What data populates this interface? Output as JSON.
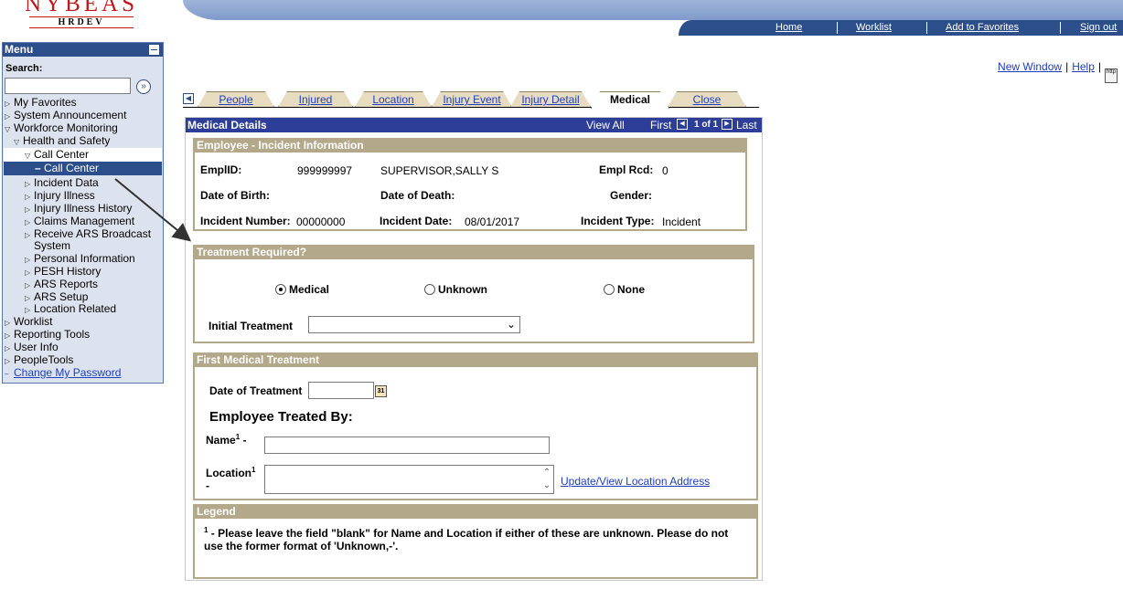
{
  "header": {
    "brand": "NYBEAS",
    "environment": "HRDEV",
    "nav": [
      "Home",
      "Worklist",
      "Add to Favorites",
      "Sign out"
    ],
    "utility": {
      "new_window": "New Window",
      "help": "Help",
      "http_icon": "http"
    }
  },
  "menu": {
    "title": "Menu",
    "search_label": "Search:",
    "search_value": "",
    "items": [
      "My Favorites",
      "System Announcement",
      "Workforce Monitoring",
      "Health and Safety",
      "Call Center",
      "Call Center",
      "Incident Data",
      "Injury Illness",
      "Injury Illness History",
      "Claims Management",
      "Receive ARS Broadcast",
      "System",
      "Personal Information",
      "PESH History",
      "ARS Reports",
      "ARS Setup",
      "Location Related",
      "Worklist",
      "Reporting Tools",
      "User Info",
      "PeopleTools",
      "Change My Password"
    ]
  },
  "tabs": [
    "People",
    "Injured",
    "Location",
    "Injury Event",
    "Injury Detail",
    "Medical",
    "Close"
  ],
  "panel": {
    "title": "Medical Details",
    "view_all": "View All",
    "first": "First",
    "count": "1 of 1",
    "last": "Last"
  },
  "employee_info": {
    "title": "Employee - Incident Information",
    "emplid_label": "EmplID:",
    "emplid": "999999997",
    "name": "SUPERVISOR,SALLY S",
    "empl_rcd_label": "Empl Rcd:",
    "empl_rcd": "0",
    "dob_label": "Date of Birth:",
    "dod_label": "Date of Death:",
    "gender_label": "Gender:",
    "incident_number_label": "Incident Number:",
    "incident_number": "00000000",
    "incident_date_label": "Incident Date:",
    "incident_date": "08/01/2017",
    "incident_type_label": "Incident Type:",
    "incident_type": "Incident"
  },
  "treatment": {
    "title": "Treatment Required?",
    "options": [
      "Medical",
      "Unknown",
      "None"
    ],
    "selected": "Medical",
    "initial_treatment_label": "Initial Treatment",
    "initial_treatment_value": ""
  },
  "first_medical": {
    "title": "First Medical Treatment",
    "date_label": "Date of Treatment",
    "date_value": "",
    "calendar_icon": "31",
    "treated_by": "Employee Treated By:",
    "name_label": "Name",
    "name_sup": "1",
    "name_suffix": "-",
    "location_label": "Location",
    "location_sup": "1",
    "location_suffix": "-",
    "update_link": "Update/View Location Address"
  },
  "legend": {
    "title": "Legend",
    "sup": "1",
    "text": " - Please leave the field \"blank\" for Name and Location if either of these are unknown. Please do not use the former format of 'Unknown,-'."
  },
  "colors": {
    "menu_head": "#2c4e8a",
    "panel_head": "#2c3e97",
    "group_head": "#b4a88a",
    "tab_bg": "#e8dcc0",
    "link": "#1f3fbf"
  }
}
